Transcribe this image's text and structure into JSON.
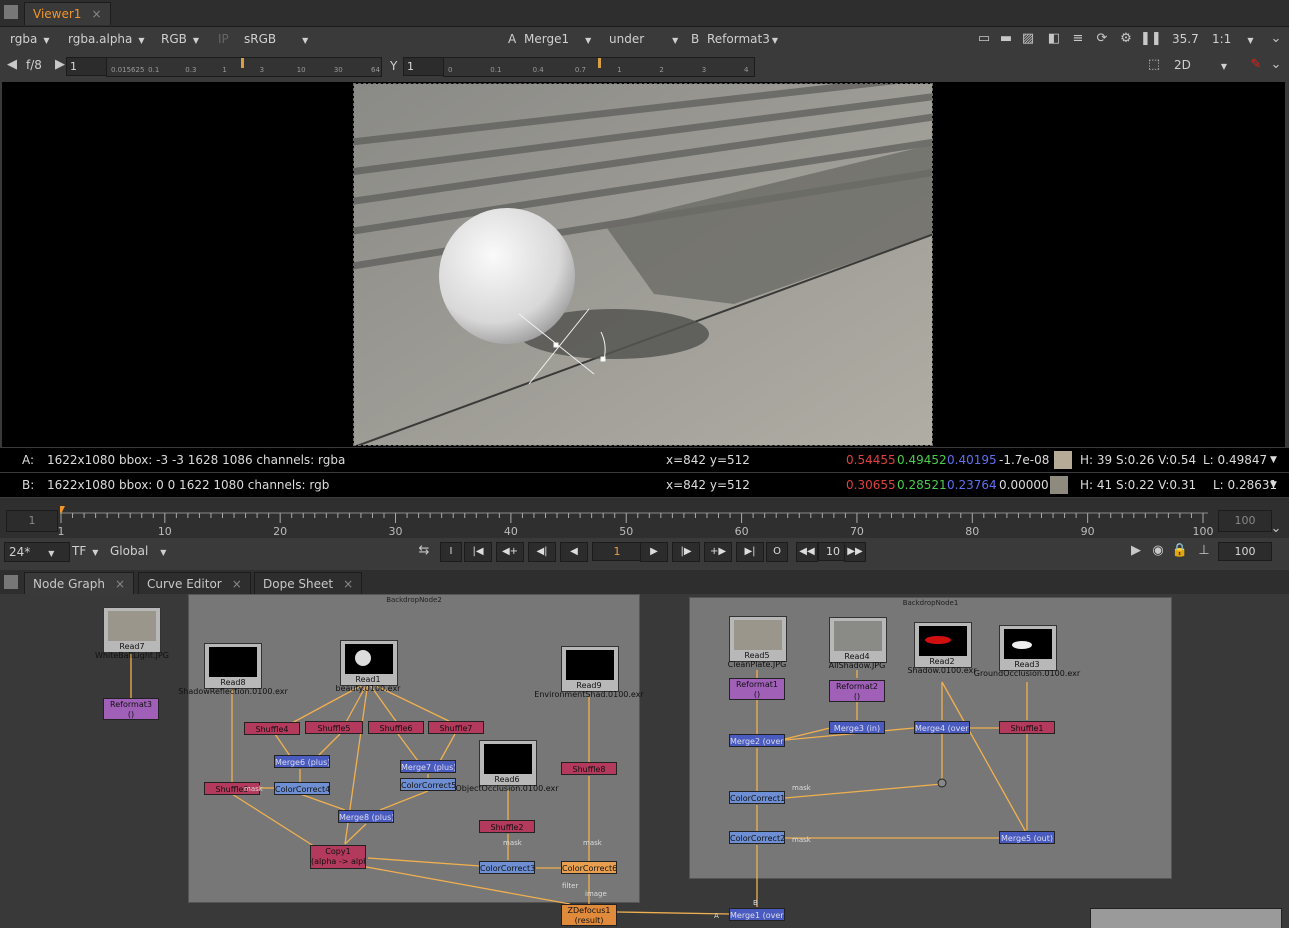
{
  "viewer_tab": {
    "label": "Viewer1",
    "close": "×"
  },
  "toolbar1": {
    "channels": "rgba",
    "alpha_channel": "rgba.alpha",
    "display": "RGB",
    "ip": "IP",
    "colorspace": "sRGB",
    "a_label": "A",
    "a_input": "Merge1",
    "blend_mode": "under",
    "b_label": "B",
    "b_input": "Reformat3",
    "zoom_value": "35.7",
    "proxy": "1:1"
  },
  "toolbar2": {
    "fstop": "f/8",
    "gain": "1",
    "gain_ticks": [
      "0.015625",
      "0.1",
      "0.3",
      "1",
      "3",
      "10",
      "30",
      "64"
    ],
    "y_label": "Y",
    "gamma": "1",
    "gamma_ticks": [
      "0",
      "0.1",
      "0.4",
      "0.7",
      "1",
      "2",
      "3",
      "4"
    ],
    "view_mode": "2D"
  },
  "info_a": {
    "label": "A:",
    "format": "1622x1080  bbox: -3 -3 1628 1086 channels: rgba",
    "coords": "x=842 y=512",
    "r": "0.54455",
    "g": "0.49452",
    "b": "0.40195",
    "a": "-1.7e-08",
    "hsv": "H: 39 S:0.26 V:0.54",
    "l": "L: 0.49847",
    "swatch": "#b5ab97"
  },
  "info_b": {
    "label": "B:",
    "format": "1622x1080  bbox: 0 0 1622 1080 channels: rgb",
    "coords": "x=842 y=512",
    "r": "0.30655",
    "g": "0.28521",
    "b": "0.23764",
    "a": "0.00000",
    "hsv": "H: 41 S:0.22 V:0.31",
    "l": "L: 0.28631",
    "swatch": "#8f8a7e"
  },
  "timeline": {
    "start": "1",
    "end": "100",
    "ticks": [
      "1",
      "10",
      "20",
      "30",
      "40",
      "50",
      "60",
      "70",
      "80",
      "90",
      "100"
    ],
    "current_marker": 1
  },
  "playback": {
    "fps": "24*",
    "tf": "TF",
    "scope": "Global",
    "frame": "1",
    "step": "10",
    "end_frame": "100"
  },
  "panel_tabs": [
    {
      "label": "Node Graph"
    },
    {
      "label": "Curve Editor"
    },
    {
      "label": "Dope Sheet"
    }
  ],
  "backdrops": [
    {
      "title": "BackdropNode2"
    },
    {
      "title": "BackdropNode1"
    }
  ],
  "reads": [
    {
      "name": "Read7",
      "file": "WhiteBallLight.JPG"
    },
    {
      "name": "Read8",
      "file": "ShadowReflection.0100.exr"
    },
    {
      "name": "Read1",
      "file": "beauty.0100.exr"
    },
    {
      "name": "Read9",
      "file": "EnvironmentShad.0100.exr"
    },
    {
      "name": "Read6",
      "file": "ObjectOcclusion.0100.exr"
    },
    {
      "name": "Read5",
      "file": "CleanPlate.JPG"
    },
    {
      "name": "Read4",
      "file": "AllShadow.JPG"
    },
    {
      "name": "Read2",
      "file": "Shadow.0100.exr"
    },
    {
      "name": "Read3",
      "file": "GroundOcclusion.0100.exr"
    }
  ],
  "nodes": {
    "reformat3": "Reformat3\n()",
    "shuffle4": "Shuffle4",
    "shuffle5": "Shuffle5",
    "shuffle6": "Shuffle6",
    "shuffle7": "Shuffle7",
    "merge6": "Merge6 (plus)",
    "merge7": "Merge7 (plus)",
    "shuffle3": "Shuffle3",
    "colorcorrect4": "ColorCorrect4",
    "colorcorrect5": "ColorCorrect5",
    "merge8": "Merge8 (plus)",
    "shuffle8": "Shuffle8",
    "shuffle2": "Shuffle2",
    "copy1": "Copy1",
    "copy1_sub": "(alpha -> alpha)",
    "colorcorrect3": "ColorCorrect3",
    "colorcorrect6": "ColorCorrect6",
    "zdefocus1": "ZDefocus1",
    "zdefocus1_sub": "(result)",
    "reformat1": "Reformat1",
    "reformat2": "Reformat2",
    "paren": "()",
    "merge3": "Merge3 (in)",
    "merge4": "Merge4 (over)",
    "shuffle1": "Shuffle1",
    "merge2": "Merge2 (over)",
    "colorcorrect1": "ColorCorrect1",
    "colorcorrect2": "ColorCorrect2",
    "merge5": "Merge5 (out)",
    "merge1": "Merge1 (over)"
  },
  "pipe_labels": {
    "mask": "mask",
    "filter": "filter",
    "image": "image",
    "a": "A",
    "b": "B"
  },
  "colors": {
    "viewer_tab_accent": "#f0962a",
    "shuffle": "#b33a5c",
    "merge": "#4a5bc0",
    "colorcorrect": "#6f8fd4",
    "reformat": "#a060b8",
    "zdefocus": "#e08a3c",
    "pipe": "#f0b050"
  }
}
